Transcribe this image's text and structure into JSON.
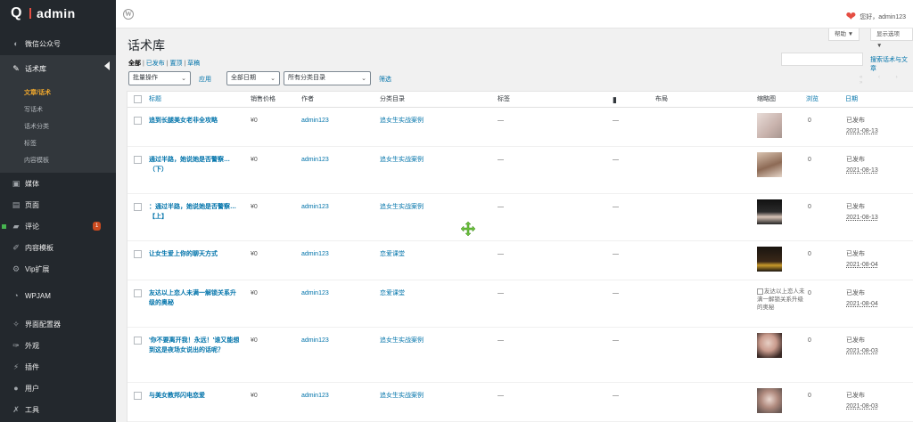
{
  "brand": {
    "logo_q": "Q",
    "logo_text": "admin"
  },
  "sidebar": {
    "items": [
      {
        "label": "微信公众号",
        "icon": "wechat-icon"
      },
      {
        "label": "话术库",
        "icon": "pin-icon"
      },
      {
        "label": "媒体",
        "icon": "media-icon"
      },
      {
        "label": "页面",
        "icon": "pages-icon"
      },
      {
        "label": "评论",
        "icon": "comments-icon",
        "badge": "1"
      },
      {
        "label": "内容模板",
        "icon": "template-icon"
      },
      {
        "label": "Vip扩展",
        "icon": "gear-icon"
      },
      {
        "label": "WPJAM",
        "icon": "dashboard-icon"
      },
      {
        "label": "界面配置器",
        "icon": "wrench-icon"
      },
      {
        "label": "外观",
        "icon": "brush-icon"
      },
      {
        "label": "插件",
        "icon": "plugin-icon"
      },
      {
        "label": "用户",
        "icon": "user-icon"
      },
      {
        "label": "工具",
        "icon": "tools-icon"
      }
    ],
    "submenu": [
      "文章/话术",
      "写话术",
      "话术分类",
      "标签",
      "内容模板"
    ]
  },
  "topbar": {
    "greeting": "您好，admin123",
    "help": "帮助 ▼",
    "screen_options": "显示选项 ▼"
  },
  "page": {
    "title": "话术库"
  },
  "filters": {
    "all": "全部",
    "all_count": "",
    "published": "已发布",
    "draft": "置顶",
    "pending": "草稿",
    "bulk": "批量操作",
    "apply": "应用",
    "date": "全部日期",
    "category": "所有分类目录",
    "filter": "筛选",
    "search_button": "搜索话术与文章"
  },
  "columns": {
    "title": "标题",
    "price": "销售价格",
    "author": "作者",
    "category": "分类目录",
    "tags": "标签",
    "comment_icon": "comment-icon",
    "layout": "布局",
    "thumb": "缩略图",
    "views": "浏览",
    "date": "日期"
  },
  "rows": [
    {
      "title": "追到长腿美女老非全攻略",
      "price": "¥0",
      "author": "admin123",
      "category": "追女生实战案例",
      "tags": "—",
      "comments": "—",
      "views": "0",
      "status": "已发布",
      "date": "2021-08-13",
      "thumb": "th1"
    },
    {
      "title": "通过半路，她说她是否警察…（下）",
      "price": "¥0",
      "author": "admin123",
      "category": "追女生实战案例",
      "tags": "—",
      "comments": "—",
      "views": "0",
      "status": "已发布",
      "date": "2021-08-13",
      "thumb": "th2"
    },
    {
      "title": "：通过半路，她说她是否警察…【上】",
      "price": "¥0",
      "author": "admin123",
      "category": "追女生实战案例",
      "tags": "—",
      "comments": "—",
      "views": "0",
      "status": "已发布",
      "date": "2021-08-13",
      "thumb": "th3"
    },
    {
      "title": "让女生爱上你的聊天方式",
      "price": "¥0",
      "author": "admin123",
      "category": "恋爱课堂",
      "tags": "—",
      "comments": "—",
      "views": "0",
      "status": "已发布",
      "date": "2021-08-04",
      "thumb": "th4"
    },
    {
      "title": "友达以上恋人未满一解锁关系升级的奥秘",
      "price": "¥0",
      "author": "admin123",
      "category": "恋爱课堂",
      "tags": "—",
      "comments": "—",
      "views": "0",
      "status": "已发布",
      "date": "2021-08-04",
      "thumb": "broken",
      "thumb_alt": "友达以上恋人未满一解锁关系升级的奥秘"
    },
    {
      "title": "'你不要离开我！永远！'谁又能想到这是夜场女说出的话呢？",
      "price": "¥0",
      "author": "admin123",
      "category": "追女生实战案例",
      "tags": "—",
      "comments": "—",
      "views": "0",
      "status": "已发布",
      "date": "2021-08-03",
      "thumb": "th6"
    },
    {
      "title": "与美女教邦闪电恋爱",
      "price": "¥0",
      "author": "admin123",
      "category": "追女生实战案例",
      "tags": "—",
      "comments": "—",
      "views": "0",
      "status": "已发布",
      "date": "2021-08-03",
      "thumb": "th7"
    }
  ],
  "colors": {
    "sidebar": "#23282d",
    "accent": "#0073aa",
    "current": "#f1a92e",
    "badge": "#ca4a1f"
  }
}
